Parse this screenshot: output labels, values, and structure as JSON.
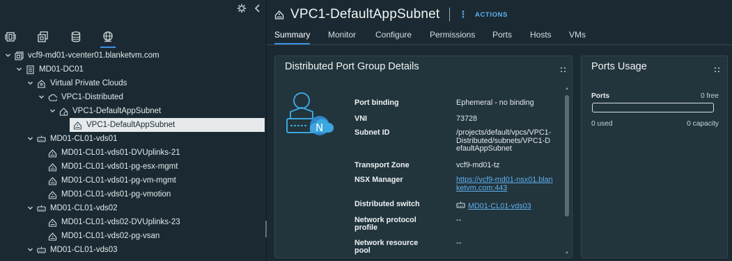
{
  "tree": {
    "items": [
      {
        "label": "vcf9-md01-vcenter01.blanketvm.com",
        "icon": "vcenter-icon",
        "level": 0,
        "caret": "down"
      },
      {
        "label": "MD01-DC01",
        "icon": "datacenter-icon",
        "level": 1,
        "caret": "down"
      },
      {
        "label": "Virtual Private Clouds",
        "icon": "vpc-folder-icon",
        "level": 2,
        "caret": "down"
      },
      {
        "label": "VPC1-Distributed",
        "icon": "vpc-icon",
        "level": 3,
        "caret": "down"
      },
      {
        "label": "VPC1-DefaultAppSubnet",
        "icon": "subnet-icon",
        "level": 4,
        "caret": "down"
      },
      {
        "label": "VPC1-DefaultAppSubnet",
        "icon": "portgroup-icon",
        "level": 5,
        "caret": "none",
        "selected": true
      },
      {
        "label": "MD01-CL01-vds01",
        "icon": "vds-icon",
        "level": 2,
        "caret": "down"
      },
      {
        "label": "MD01-CL01-vds01-DVUplinks-21",
        "icon": "portgroup-icon",
        "level": 3,
        "caret": "none"
      },
      {
        "label": "MD01-CL01-vds01-pg-esx-mgmt",
        "icon": "portgroup-icon",
        "level": 3,
        "caret": "none"
      },
      {
        "label": "MD01-CL01-vds01-pg-vm-mgmt",
        "icon": "portgroup-icon",
        "level": 3,
        "caret": "none"
      },
      {
        "label": "MD01-CL01-vds01-pg-vmotion",
        "icon": "portgroup-icon",
        "level": 3,
        "caret": "none"
      },
      {
        "label": "MD01-CL01-vds02",
        "icon": "vds-icon",
        "level": 2,
        "caret": "down"
      },
      {
        "label": "MD01-CL01-vds02-DVUplinks-23",
        "icon": "portgroup-icon",
        "level": 3,
        "caret": "none"
      },
      {
        "label": "MD01-CL01-vds02-pg-vsan",
        "icon": "portgroup-icon",
        "level": 3,
        "caret": "none"
      },
      {
        "label": "MD01-CL01-vds03",
        "icon": "vds-icon",
        "level": 2,
        "caret": "down"
      }
    ]
  },
  "header": {
    "title": "VPC1-DefaultAppSubnet",
    "actions_label": "ACTIONS",
    "icon": "portgroup-icon"
  },
  "tabs": [
    "Summary",
    "Monitor",
    "Configure",
    "Permissions",
    "Ports",
    "Hosts",
    "VMs"
  ],
  "active_tab": "Summary",
  "details_card": {
    "title": "Distributed Port Group Details",
    "rows": [
      {
        "label": "Port binding",
        "value": "Ephemeral - no binding"
      },
      {
        "label": "VNI",
        "value": "73728"
      },
      {
        "label": "Subnet ID",
        "value": "/projects/default/vpcs/VPC1-Distributed/subnets/VPC1-DefaultAppSubnet"
      },
      {
        "label": "Transport Zone",
        "value": "vcf9-md01-tz"
      },
      {
        "label": "NSX Manager",
        "value": "https://vcf9-md01-nsx01.blanketvm.com:443",
        "link": true
      },
      {
        "label": "Distributed switch",
        "value": "MD01-CL01-vds03",
        "link": true,
        "icon": "vds-icon"
      },
      {
        "label": "Network protocol profile",
        "value": "--"
      },
      {
        "label": "Network resource pool",
        "value": "--"
      }
    ]
  },
  "ports_card": {
    "title": "Ports Usage",
    "ports_label": "Ports",
    "free": "0 free",
    "used": "0 used",
    "capacity": "0 capacity",
    "usage_fraction": 0
  },
  "colors": {
    "background": "#1b2a32",
    "card": "#22343c",
    "accent": "#3e8ee8",
    "link": "#5fb1ef",
    "selected_row": "#e6eaec"
  }
}
